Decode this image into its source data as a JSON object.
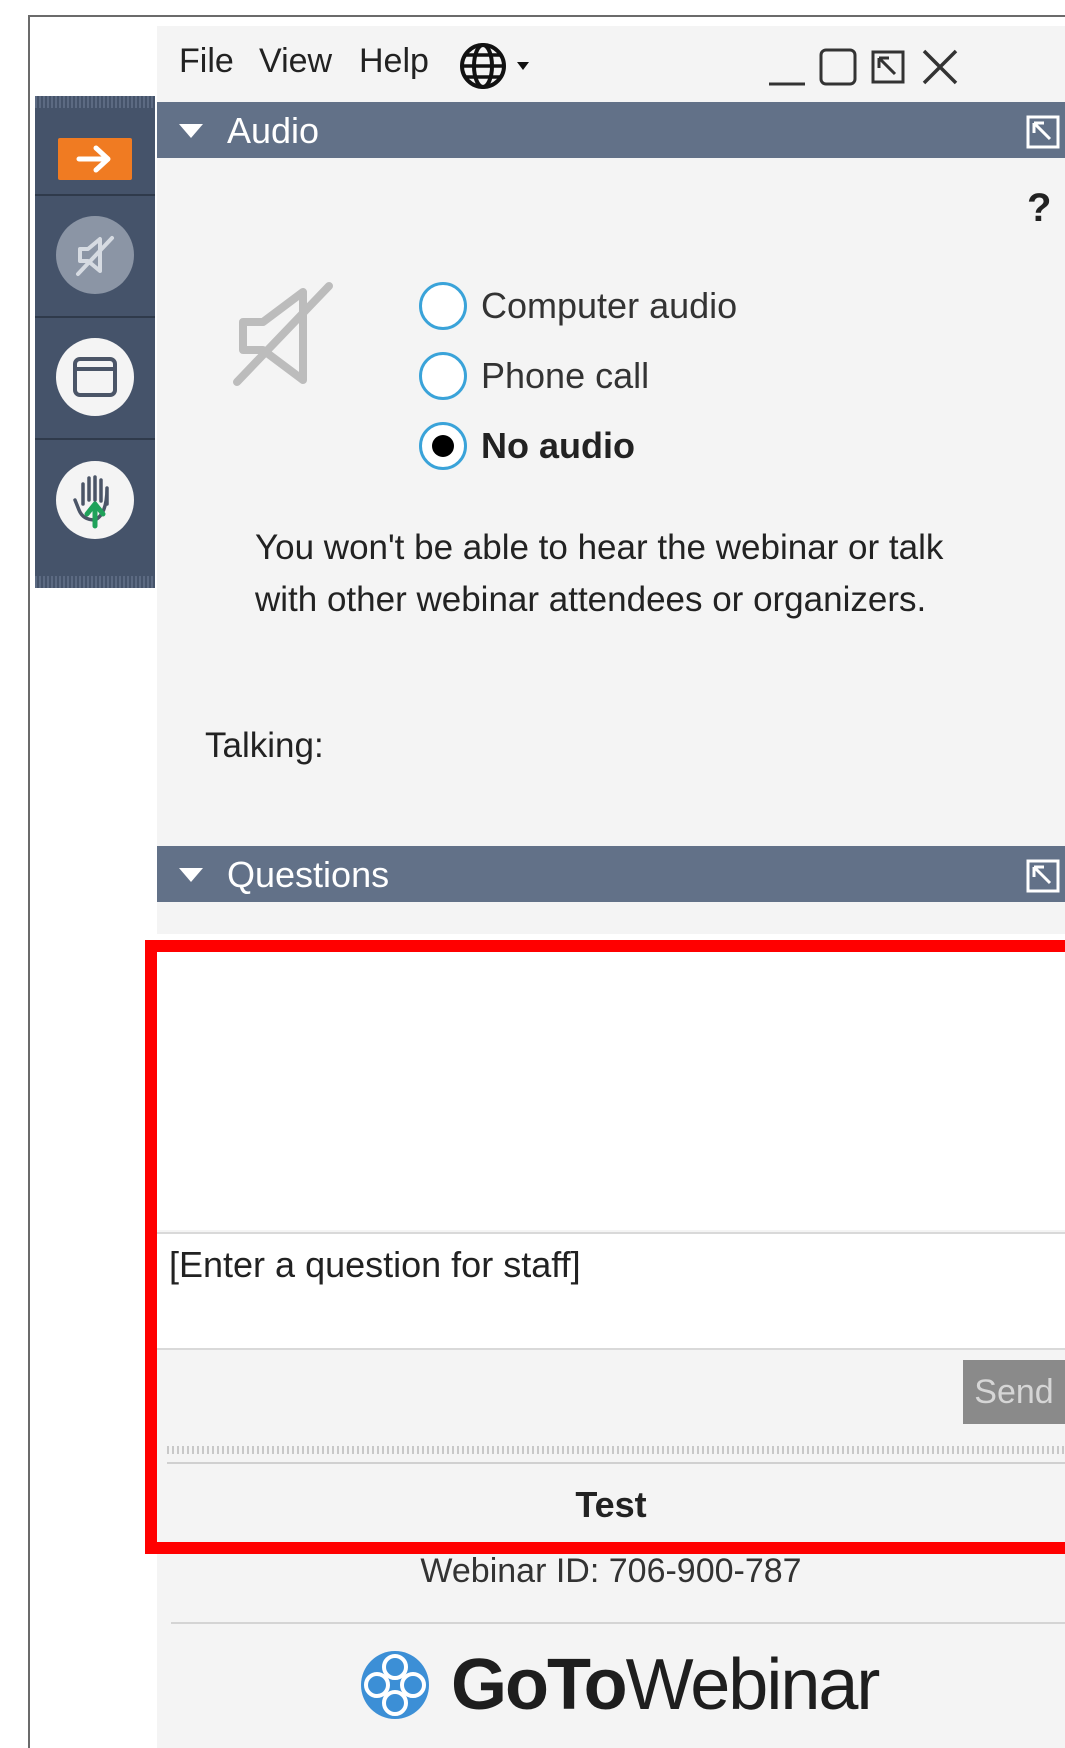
{
  "menubar": {
    "file": "File",
    "view": "View",
    "help": "Help"
  },
  "icons": {
    "language": "globe-icon",
    "minimize": "minimize-icon",
    "maximize": "maximize-icon",
    "popout": "popout-icon",
    "close": "close-icon"
  },
  "toolbar": {
    "accent_color": "#f07b22",
    "bg_color": "#45536a"
  },
  "audio": {
    "section_title": "Audio",
    "help_label": "?",
    "options": [
      {
        "label": "Computer audio",
        "selected": false
      },
      {
        "label": "Phone call",
        "selected": false
      },
      {
        "label": "No audio",
        "selected": true
      }
    ],
    "info": "You won't be able to hear the webinar or talk with other webinar attendees or organizers.",
    "talking_label": "Talking:"
  },
  "questions": {
    "section_title": "Questions",
    "input_placeholder": "[Enter a question for staff]",
    "send_label": "Send"
  },
  "footer": {
    "webinar_title": "Test",
    "webinar_id": "Webinar ID: 706-900-787",
    "logo_bold": "GoTo",
    "logo_light": "Webinar"
  },
  "colors": {
    "section_bar": "#627188",
    "radio_ring": "#3aa3d9",
    "highlight": "#ff0000"
  }
}
